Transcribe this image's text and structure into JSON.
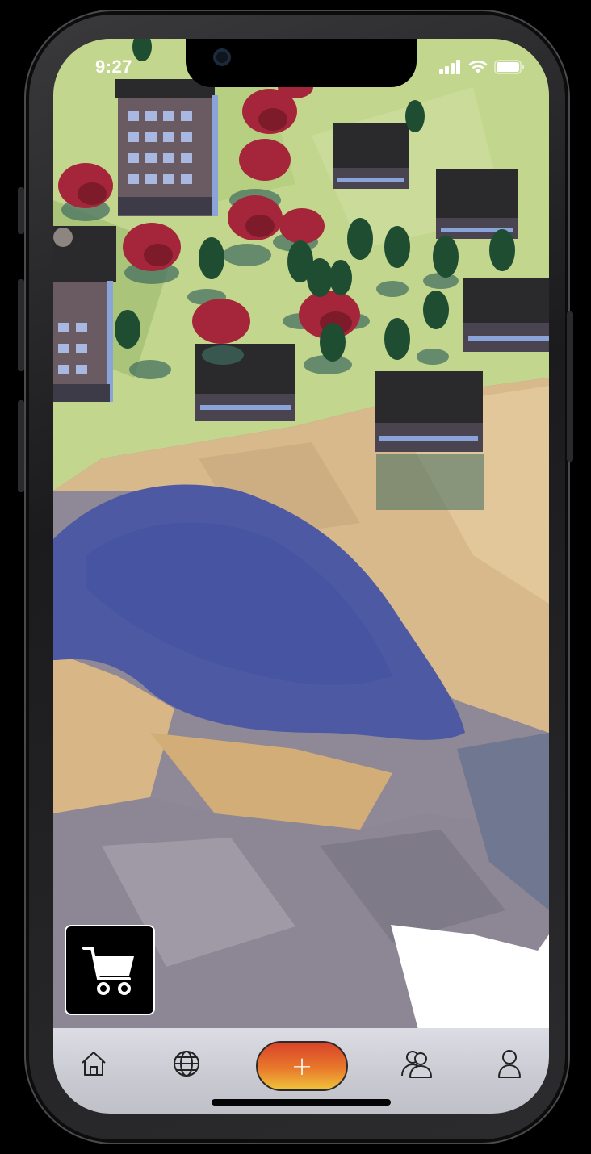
{
  "status_bar": {
    "time": "9:27",
    "icons": [
      "cellular-signal-icon",
      "wifi-icon",
      "battery-icon"
    ]
  },
  "scene": {
    "description_icon": "low-poly-3d-town-map"
  },
  "cart": {
    "icon": "shopping-cart-icon"
  },
  "bottom_nav": {
    "items": [
      {
        "id": "home",
        "icon": "home-icon"
      },
      {
        "id": "globe",
        "icon": "globe-icon"
      },
      {
        "id": "add",
        "icon": "plus-icon",
        "label": "+"
      },
      {
        "id": "community",
        "icon": "people-icon"
      },
      {
        "id": "profile",
        "icon": "user-icon"
      }
    ]
  },
  "colors": {
    "grass": "#c3d68e",
    "sand": "#d7b98c",
    "water": "#4d5aa3",
    "rock": "#8f8896",
    "tree_red": "#a5263a",
    "tree_green": "#1f4d32",
    "roof": "#2a2a2c",
    "add_gradient_top": "#d9432a",
    "add_gradient_bottom": "#f0c23a",
    "nav_background": "#d3d4dc"
  }
}
